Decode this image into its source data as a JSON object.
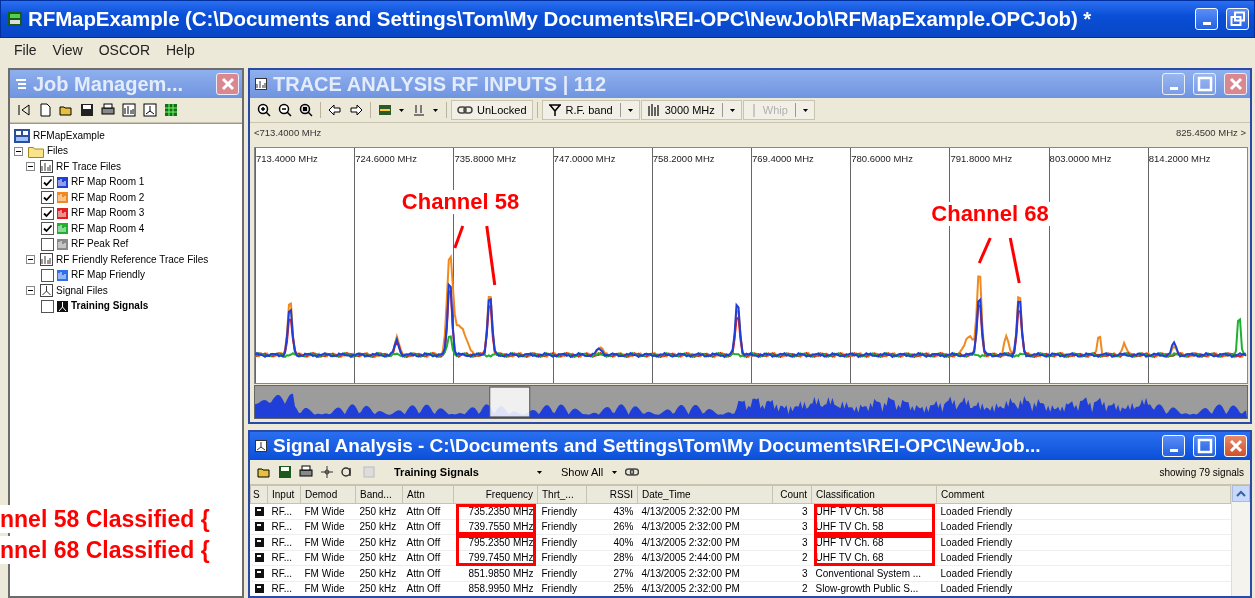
{
  "window": {
    "title": "RFMapExample (C:\\Documents and Settings\\Tom\\My Documents\\REI-OPC\\NewJob\\RFMapExample.OPCJob) *"
  },
  "menu": [
    "File",
    "View",
    "OSCOR",
    "Help"
  ],
  "job_panel": {
    "title": "Job Managem...",
    "active": false,
    "tree": [
      {
        "label": "RFMapExample",
        "kind": "project"
      },
      {
        "label": "Files",
        "kind": "folder",
        "expanded": true,
        "children": [
          {
            "label": "RF Trace Files",
            "kind": "trace-group",
            "expanded": true,
            "children": [
              {
                "label": "RF Map Room 1",
                "kind": "trace",
                "checked": true,
                "selected": false,
                "color": "#1f3fd8"
              },
              {
                "label": "RF Map Room 2",
                "kind": "trace",
                "checked": true,
                "selected": false,
                "color": "#f08a20"
              },
              {
                "label": "RF Map Room 3",
                "kind": "trace",
                "checked": true,
                "selected": false,
                "color": "#e02020"
              },
              {
                "label": "RF Map Room 4",
                "kind": "trace",
                "checked": true,
                "selected": false,
                "color": "#20b030"
              },
              {
                "label": "RF Peak Ref",
                "kind": "trace",
                "checked": false,
                "selected": false,
                "color": "#8a8a8a"
              }
            ]
          },
          {
            "label": "RF Friendly Reference Trace Files",
            "kind": "trace-group",
            "expanded": true,
            "children": [
              {
                "label": "RF Map Friendly",
                "kind": "trace",
                "checked": false,
                "selected": false,
                "color": "#2f6fe8"
              }
            ]
          },
          {
            "label": "Signal Files",
            "kind": "signal-group",
            "expanded": true,
            "children": [
              {
                "label": "Training Signals",
                "kind": "signal",
                "checked": false,
                "selected": true,
                "color": "#111111"
              }
            ]
          }
        ]
      }
    ]
  },
  "trace_panel": {
    "title": "TRACE ANALYSIS RF INPUTS | 112",
    "active": false,
    "lock_button": {
      "label": "UnLocked"
    },
    "band_button": {
      "label": "R.F. band"
    },
    "span_button": {
      "label": "3000 MHz"
    },
    "antenna_button": {
      "label": "Whip",
      "disabled": true
    },
    "range_start": "<713.4000 MHz",
    "range_end": "825.4500 MHz >",
    "grid_labels": [
      "713.4000 MHz",
      "724.6000 MHz",
      "735.8000 MHz",
      "747.0000 MHz",
      "758.2000 MHz",
      "769.4000 MHz",
      "780.6000 MHz",
      "791.8000 MHz",
      "803.0000 MHz",
      "814.2000 MHz"
    ],
    "callouts": [
      {
        "label": "Channel 58"
      },
      {
        "label": "Channel 68"
      }
    ]
  },
  "signal_panel": {
    "title": "Signal Analysis - C:\\Documents and Settings\\Tom\\My Documents\\REI-OPC\\NewJob...",
    "active": true,
    "file_select": "Training Signals",
    "filter_select": "Show All",
    "count": "showing 79 signals",
    "table": {
      "columns": [
        "S",
        "Input",
        "Demod",
        "Band...",
        "Attn",
        "Frequency",
        "Thrt_...",
        "RSSI",
        "Date_Time",
        "Count",
        "Classification",
        "Comment"
      ],
      "row_groups": [
        {
          "highlighted": true,
          "annotation": "nnel 58 Classified {",
          "rows": [
            {
              "cells": [
                "RF...",
                "FM Wide",
                "250 kHz",
                "Attn Off",
                "735.2350 MHz",
                "Friendly",
                "43%",
                "4/13/2005 2:32:00 PM",
                "3",
                "UHF TV Ch. 58",
                "Loaded Friendly"
              ]
            },
            {
              "cells": [
                "RF...",
                "FM Wide",
                "250 kHz",
                "Attn Off",
                "739.7550 MHz",
                "Friendly",
                "26%",
                "4/13/2005 2:32:00 PM",
                "3",
                "UHF TV Ch. 58",
                "Loaded Friendly"
              ]
            }
          ]
        },
        {
          "highlighted": true,
          "annotation": "nnel 68 Classified {",
          "rows": [
            {
              "cells": [
                "RF...",
                "FM Wide",
                "250 kHz",
                "Attn Off",
                "795.2350 MHz",
                "Friendly",
                "40%",
                "4/13/2005 2:32:00 PM",
                "3",
                "UHF TV Ch. 68",
                "Loaded Friendly"
              ]
            },
            {
              "cells": [
                "RF...",
                "FM Wide",
                "250 kHz",
                "Attn Off",
                "799.7450 MHz",
                "Friendly",
                "28%",
                "4/13/2005 2:44:00 PM",
                "2",
                "UHF TV Ch. 68",
                "Loaded Friendly"
              ]
            }
          ]
        },
        {
          "highlighted": false,
          "rows": [
            {
              "cells": [
                "RF...",
                "FM Wide",
                "250 kHz",
                "Attn Off",
                "851.9850 MHz",
                "Friendly",
                "27%",
                "4/13/2005 2:32:00 PM",
                "3",
                "Conventional System ...",
                "Loaded Friendly"
              ]
            },
            {
              "cells": [
                "RF...",
                "FM Wide",
                "250 kHz",
                "Attn Off",
                "858.9950 MHz",
                "Friendly",
                "25%",
                "4/13/2005 2:32:00 PM",
                "2",
                "Slow-growth Public S...",
                "Loaded Friendly"
              ]
            }
          ]
        }
      ]
    }
  }
}
